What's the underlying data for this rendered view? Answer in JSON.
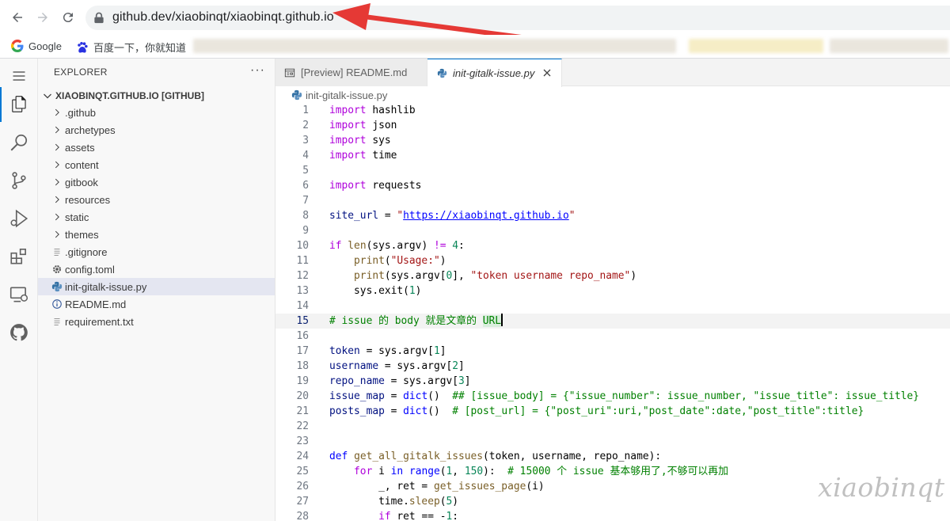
{
  "browser": {
    "url": "github.dev/xiaobinqt/xiaobinqt.github.io",
    "bookmarks": [
      {
        "label": "Google",
        "icon": "google-icon"
      },
      {
        "label": "百度一下，你就知道",
        "icon": "baidu-icon"
      }
    ]
  },
  "explorer": {
    "title": "EXPLORER",
    "more": "···",
    "root_label": "XIAOBINQT.GITHUB.IO [GITHUB]",
    "items": [
      {
        "label": ".github",
        "kind": "folder"
      },
      {
        "label": "archetypes",
        "kind": "folder"
      },
      {
        "label": "assets",
        "kind": "folder"
      },
      {
        "label": "content",
        "kind": "folder"
      },
      {
        "label": "gitbook",
        "kind": "folder"
      },
      {
        "label": "resources",
        "kind": "folder"
      },
      {
        "label": "static",
        "kind": "folder"
      },
      {
        "label": "themes",
        "kind": "folder"
      },
      {
        "label": ".gitignore",
        "kind": "file-lines"
      },
      {
        "label": "config.toml",
        "kind": "gear"
      },
      {
        "label": "init-gitalk-issue.py",
        "kind": "python",
        "selected": true
      },
      {
        "label": "README.md",
        "kind": "info"
      },
      {
        "label": "requirement.txt",
        "kind": "file-lines"
      }
    ]
  },
  "tabs": [
    {
      "label": "[Preview] README.md",
      "active": false
    },
    {
      "label": "init-gitalk-issue.py",
      "active": true
    }
  ],
  "breadcrumb": "init-gitalk-issue.py",
  "code": {
    "current_line": 15,
    "lines": [
      {
        "n": "1"
      },
      {
        "n": "2"
      },
      {
        "n": "3"
      },
      {
        "n": "4"
      },
      {
        "n": "5"
      },
      {
        "n": "6"
      },
      {
        "n": "7"
      },
      {
        "n": "8"
      },
      {
        "n": "9"
      },
      {
        "n": "10"
      },
      {
        "n": "11"
      },
      {
        "n": "12"
      },
      {
        "n": "13"
      },
      {
        "n": "14"
      },
      {
        "n": "15"
      },
      {
        "n": "16"
      },
      {
        "n": "17"
      },
      {
        "n": "18"
      },
      {
        "n": "19"
      },
      {
        "n": "20"
      },
      {
        "n": "21"
      },
      {
        "n": "22"
      },
      {
        "n": "23"
      },
      {
        "n": "24"
      },
      {
        "n": "25"
      },
      {
        "n": "26"
      },
      {
        "n": "27"
      },
      {
        "n": "28"
      }
    ],
    "text": {
      "l1a": "import",
      "l1b": " hashlib",
      "l2a": "import",
      "l2b": " json",
      "l3a": "import",
      "l3b": " sys",
      "l4a": "import",
      "l4b": " time",
      "l6a": "import",
      "l6b": " requests",
      "l8a": "site_url",
      "l8b": " = ",
      "l8c": "\"",
      "l8d": "https://xiaobinqt.github.io",
      "l8e": "\"",
      "l10a": "if",
      "l10b": " ",
      "l10c": "len",
      "l10d": "(sys.argv) ",
      "l10e": "!=",
      "l10f": " ",
      "l10g": "4",
      "l10h": ":",
      "l11a": "    ",
      "l11b": "print",
      "l11c": "(",
      "l11d": "\"Usage:\"",
      "l11e": ")",
      "l12a": "    ",
      "l12b": "print",
      "l12c": "(sys.argv[",
      "l12d": "0",
      "l12e": "], ",
      "l12f": "\"token username repo_name\"",
      "l12g": ")",
      "l13a": "    sys.exit(",
      "l13b": "1",
      "l13c": ")",
      "l15a": "# issue 的 body 就是文章的 ",
      "l15b": "URL",
      "l17a": "token",
      "l17b": " = sys.argv[",
      "l17c": "1",
      "l17d": "]",
      "l18a": "username",
      "l18b": " = sys.argv[",
      "l18c": "2",
      "l18d": "]",
      "l19a": "repo_name",
      "l19b": " = sys.argv[",
      "l19c": "3",
      "l19d": "]",
      "l20a": "issue_map",
      "l20b": " = ",
      "l20c": "dict",
      "l20d": "()  ",
      "l20e": "## [issue_body] = {\"issue_number\": issue_number, \"issue_title\": issue_title}",
      "l21a": "posts_map",
      "l21b": " = ",
      "l21c": "dict",
      "l21d": "()  ",
      "l21e": "# [post_url] = {\"post_uri\":uri,\"post_date\":date,\"post_title\":title}",
      "l24a": "def",
      "l24b": " ",
      "l24c": "get_all_gitalk_issues",
      "l24d": "(token, username, repo_name):",
      "l25a": "    ",
      "l25b": "for",
      "l25c": " i ",
      "l25d": "in",
      "l25e": " ",
      "l25f": "range",
      "l25g": "(",
      "l25h": "1",
      "l25i": ", ",
      "l25j": "150",
      "l25k": "):  ",
      "l25l": "# 15000 个 issue 基本够用了,不够可以再加",
      "l26a": "        _, ret = ",
      "l26b": "get_issues_page",
      "l26c": "(i)",
      "l27a": "        time.",
      "l27b": "sleep",
      "l27c": "(",
      "l27d": "5",
      "l27e": ")",
      "l28a": "        ",
      "l28b": "if",
      "l28c": " ret ",
      "l28d": "==",
      "l28e": " -",
      "l28f": "1",
      "l28g": ":"
    }
  },
  "watermark": "xiaobinqt",
  "colors": {
    "accent": "#0078d4",
    "arrow": "#e53935"
  }
}
